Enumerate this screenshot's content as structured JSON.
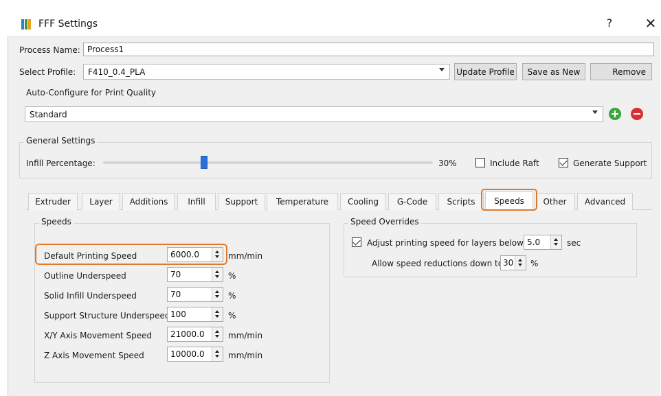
{
  "window": {
    "title": "FFF Settings",
    "help_glyph": "?",
    "close_glyph": "✕"
  },
  "process": {
    "label": "Process Name:",
    "value": "Process1"
  },
  "profile": {
    "label": "Select Profile:",
    "selected": "F410_0.4_PLA",
    "update_label": "Update Profile",
    "save_new_label": "Save as New",
    "remove_label": "Remove"
  },
  "auto_configure": {
    "title": "Auto-Configure for Print Quality",
    "selected": "Standard"
  },
  "general": {
    "title": "General Settings",
    "infill_label": "Infill Percentage:",
    "infill_value": 30,
    "infill_text": "30%",
    "include_raft_label": "Include Raft",
    "include_raft_checked": false,
    "generate_support_label": "Generate Support",
    "generate_support_checked": true
  },
  "tabs": [
    "Extruder",
    "Layer",
    "Additions",
    "Infill",
    "Support",
    "Temperature",
    "Cooling",
    "G-Code",
    "Scripts",
    "Speeds",
    "Other",
    "Advanced"
  ],
  "active_tab": "Speeds",
  "speeds": {
    "title": "Speeds",
    "rows": [
      {
        "label": "Default Printing Speed",
        "value": "6000.0",
        "unit": "mm/min"
      },
      {
        "label": "Outline Underspeed",
        "value": "70",
        "unit": "%"
      },
      {
        "label": "Solid Infill Underspeed",
        "value": "70",
        "unit": "%"
      },
      {
        "label": "Support Structure Underspeed",
        "value": "100",
        "unit": "%"
      },
      {
        "label": "X/Y Axis Movement Speed",
        "value": "21000.0",
        "unit": "mm/min"
      },
      {
        "label": "Z Axis Movement Speed",
        "value": "10000.0",
        "unit": "mm/min"
      }
    ]
  },
  "overrides": {
    "title": "Speed Overrides",
    "adjust_label": "Adjust printing speed for layers below",
    "adjust_checked": true,
    "adjust_value": "5.0",
    "adjust_unit": "sec",
    "allow_label": "Allow speed reductions down to",
    "allow_value": "30",
    "allow_unit": "%"
  },
  "colors": {
    "accent_highlight": "#e07a2a",
    "slider": "#2a72d8",
    "add_green": "#3aa53a",
    "remove_red": "#d83030"
  }
}
